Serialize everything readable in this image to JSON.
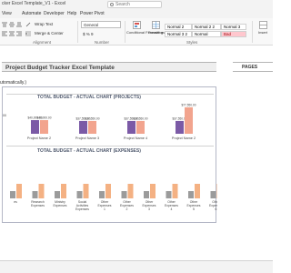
{
  "window": {
    "title": "cker Excel Template_V1 - Excel"
  },
  "search": {
    "placeholder": "Search"
  },
  "menu": [
    "View",
    "Automate",
    "Developer",
    "Help",
    "Power Pivot"
  ],
  "ribbon": {
    "wrap_text": "Wrap Text",
    "merge_center": "Merge & Center",
    "number_format": "General",
    "number_symbols": "$  %  9",
    "conditional_formatting": "Conditional Formatting",
    "format_as_table": "Format as Table",
    "styles": [
      "Normal 2",
      "Normal 2 2",
      "Normal 3",
      "Normal 3 2",
      "Normal",
      "Bad"
    ],
    "insert": "Insert",
    "groups": {
      "alignment": "Alignment",
      "number": "Number",
      "styles": "Styles"
    }
  },
  "sheet": {
    "banner_title": "Project Budget Tracker Excel Template",
    "pages_label": "PAGES",
    "note": "utomatically.)"
  },
  "chart_data": [
    {
      "type": "bar",
      "title": "TOTAL BUDGET - ACTUAL CHART (PROJECTS)",
      "categories": [
        "Project Name 2",
        "Project Name 3",
        "Project Name 4",
        "Project Name 2"
      ],
      "series": [
        {
          "values": [
            40000,
            37550,
            37550,
            37550
          ]
        },
        {
          "values": [
            40000,
            37550,
            37550,
            77550
          ]
        }
      ],
      "data_labels": [
        [
          "$40,000.00",
          "$37,550.00",
          "$37,550.00",
          "$37,550.00"
        ],
        [
          "$40,000.00",
          "$37,550.00",
          "$37,550.00",
          "$77,550.00"
        ]
      ],
      "left_edge_label": "00"
    },
    {
      "type": "bar",
      "title": "TOTAL BUDGET - ACTUAL CHART (EXPENSES)",
      "categories": [
        "es",
        "Research Expenses",
        "Ministry Expenses",
        "Social Activities Expenses",
        "Other Expenses 1",
        "Other Expenses 2",
        "Other Expenses 3",
        "Other Expenses 4",
        "Other Expenses 5",
        "Other Expenses 6"
      ],
      "series": [
        {
          "values": [
            4,
            4,
            4,
            4,
            4,
            4,
            4,
            4,
            4,
            4
          ]
        },
        {
          "values": [
            8,
            8,
            8,
            8,
            8,
            8,
            8,
            8,
            8,
            8
          ]
        }
      ]
    }
  ],
  "colors": {
    "bar_purple": "#7b5aa6",
    "bar_salmon": "#f2a48e",
    "bar_gray": "#9b9b9b",
    "bar_orange": "#f4b183",
    "chart_title": "#505a6e"
  }
}
